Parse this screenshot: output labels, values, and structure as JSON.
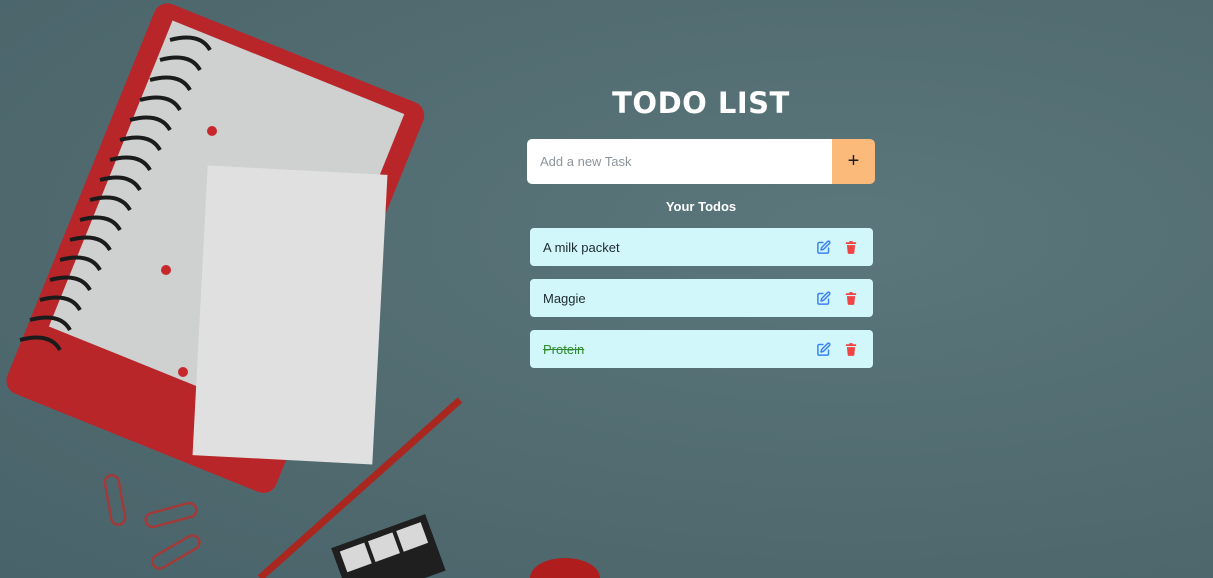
{
  "header": {
    "title": "TODO LIST"
  },
  "add_form": {
    "placeholder": "Add a new Task",
    "value": "",
    "add_button_label": "+"
  },
  "list": {
    "heading": "Your Todos",
    "items": [
      {
        "text": "A milk packet",
        "completed": false,
        "edit_icon": "edit-icon",
        "delete_icon": "trash-icon"
      },
      {
        "text": "Maggie",
        "completed": false,
        "edit_icon": "edit-icon",
        "delete_icon": "trash-icon"
      },
      {
        "text": "Protein",
        "completed": true,
        "edit_icon": "edit-icon",
        "delete_icon": "trash-icon"
      }
    ]
  },
  "colors": {
    "accent": "#fbb97a",
    "todo_bg": "#d2f7fb",
    "edit": "#3b82f6",
    "delete": "#ef4444",
    "completed_text": "#2f8a2f"
  }
}
